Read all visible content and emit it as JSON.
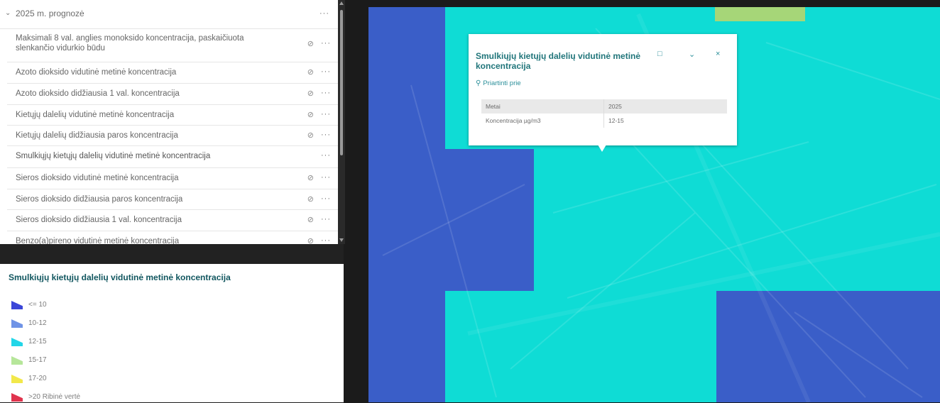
{
  "layer_list": {
    "group": {
      "title": "2025 m. prognozė",
      "expanded": true
    },
    "more_symbol": "···",
    "visibility_symbol": "⊘",
    "layers": [
      {
        "label": "Maksimali 8 val. anglies monoksido koncentracija, paskaičiuota slenkančio vidurkio būdu",
        "visible": false
      },
      {
        "label": "Azoto dioksido vidutinė metinė koncentracija",
        "visible": false
      },
      {
        "label": "Azoto dioksido didžiausia 1 val. koncentracija",
        "visible": false
      },
      {
        "label": "Kietųjų dalelių vidutinė metinė koncentracija",
        "visible": false
      },
      {
        "label": "Kietųjų dalelių didžiausia paros koncentracija",
        "visible": false
      },
      {
        "label": "Smulkiųjų kietųjų dalelių vidutinė metinė koncentracija",
        "visible": true
      },
      {
        "label": "Sieros dioksido vidutinė metinė koncentracija",
        "visible": false
      },
      {
        "label": "Sieros dioksido didžiausia paros koncentracija",
        "visible": false
      },
      {
        "label": "Sieros dioksido didžiausia 1 val. koncentracija",
        "visible": false
      },
      {
        "label": "Benzo(a)pireno vidutinė metinė koncentracija",
        "visible": false
      }
    ]
  },
  "legend": {
    "title": "Smulkiųjų kietųjų dalelių vidutinė metinė koncentracija",
    "items": [
      {
        "label": "<= 10",
        "color": "#3b46d8"
      },
      {
        "label": "10-12",
        "color": "#6f93e6"
      },
      {
        "label": "12-15",
        "color": "#22d6e8"
      },
      {
        "label": "15-17",
        "color": "#b6e69a"
      },
      {
        "label": "17-20",
        "color": "#f2e84a"
      },
      {
        "label": ">20 Ribinė vertė",
        "color": "#e0344e"
      }
    ]
  },
  "map": {
    "colors": {
      "low": "#3a5ec8",
      "mid": "#0fdcd5",
      "high": "#a6d678"
    }
  },
  "popup": {
    "title": "Smulkiųjų kietųjų dalelių vidutinė metinė koncentracija",
    "icons": {
      "dock": "dock-icon",
      "collapse": "chevron-down-icon",
      "close": "close-icon"
    },
    "zoom_link": "Priartinti prie",
    "fields": [
      {
        "key": "Metai",
        "value": "2025"
      },
      {
        "key": "Koncentracija µg/m3",
        "value": "12-15"
      }
    ]
  }
}
